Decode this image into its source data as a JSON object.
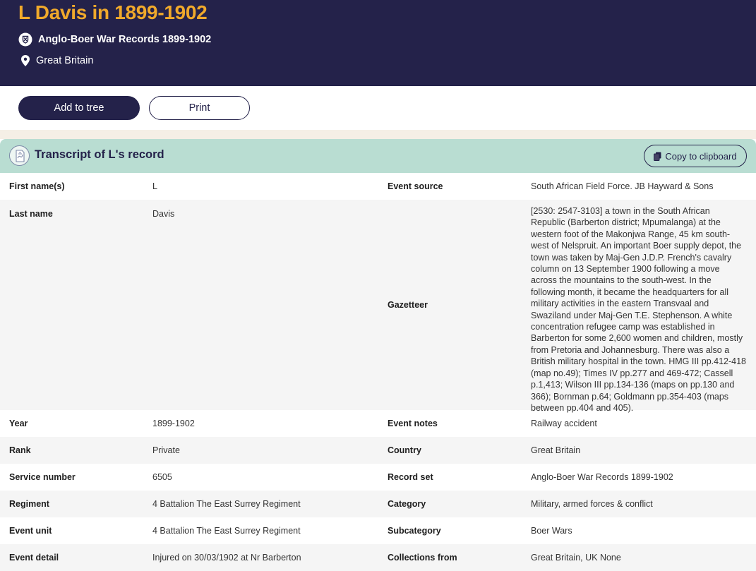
{
  "header": {
    "title": "L Davis in 1899-1902",
    "collection": "Anglo-Boer War Records 1899-1902",
    "location": "Great Britain",
    "collection_icon": "crest-icon",
    "location_icon": "map-pin-icon"
  },
  "actions": {
    "add_to_tree": "Add to tree",
    "print": "Print"
  },
  "transcript": {
    "title": "Transcript of L's record",
    "copy_label": "Copy to clipboard",
    "copy_icon": "clipboard-icon",
    "title_icon": "record-icon"
  },
  "rows": [
    {
      "label1": "First name(s)",
      "value1": "L",
      "label2": "Event source",
      "value2": "South African Field Force. JB Hayward & Sons"
    },
    {
      "label1": "Last name",
      "value1": "Davis",
      "label2": "Gazetteer",
      "value2": "[2530: 2547-3103] a town in the South African Republic (Barberton district; Mpumalanga) at the western foot of the Makonjwa Range, 45 km south-west of Nelspruit. An important Boer supply depot, the town was taken by Maj-Gen J.D.P. French's cavalry column on 13 September 1900 following a move across the mountains to the south-west. In the following month, it became the headquarters for all military activities in the eastern Transvaal and Swaziland under Maj-Gen T.E. Stephenson. A white concentration refugee camp was established in Barberton for some 2,600 women and children, mostly from Pretoria and Johannesburg. There was also a British military hospital in the town. HMG III pp.412-418 (map no.49); Times IV pp.277 and 469-472; Cassell p.1,413; Wilson III pp.134-136 (maps on pp.130 and 366); Bornman p.64; Goldmann pp.354-403 (maps between pp.404 and 405)."
    },
    {
      "label1": "Year",
      "value1": "1899-1902",
      "label2": "Event notes",
      "value2": "Railway accident"
    },
    {
      "label1": "Rank",
      "value1": "Private",
      "label2": "Country",
      "value2": "Great Britain"
    },
    {
      "label1": "Service number",
      "value1": "6505",
      "label2": "Record set",
      "value2": "Anglo-Boer War Records 1899-1902"
    },
    {
      "label1": "Regiment",
      "value1": "4 Battalion The East Surrey Regiment",
      "label2": "Category",
      "value2": "Military, armed forces & conflict"
    },
    {
      "label1": "Event unit",
      "value1": "4 Battalion The East Surrey Regiment",
      "label2": "Subcategory",
      "value2": "Boer Wars"
    },
    {
      "label1": "Event detail",
      "value1": "Injured on 30/03/1902 at Nr Barberton",
      "label2": "Collections from",
      "value2": "Great Britain, UK None"
    }
  ]
}
